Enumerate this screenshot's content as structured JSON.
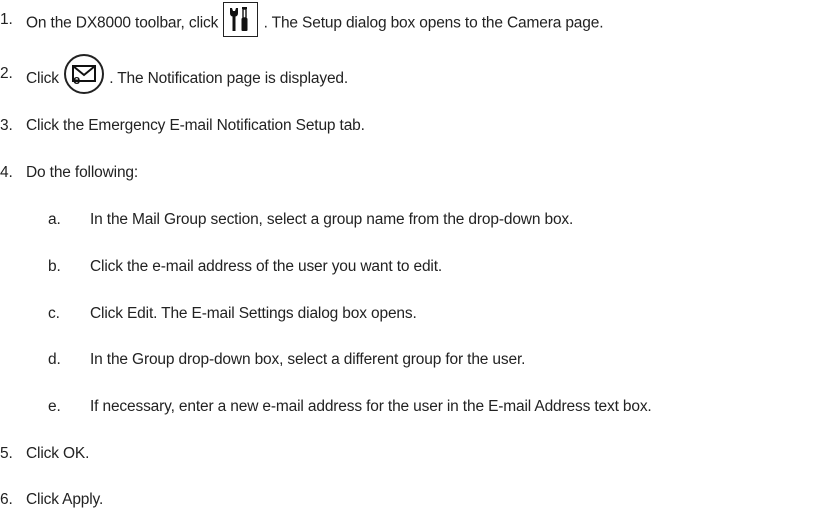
{
  "steps": [
    {
      "num": "1.",
      "before": "On the DX8000 toolbar, click",
      "after": ". The Setup dialog box opens to the Camera page.",
      "icon": "wrench-screwdriver-icon"
    },
    {
      "num": "2.",
      "before": "Click",
      "after": ". The Notification page is displayed.",
      "icon": "email-notification-icon"
    },
    {
      "num": "3.",
      "text": "Click the Emergency E-mail Notification Setup tab."
    },
    {
      "num": "4.",
      "text": "Do the following:"
    },
    {
      "num": "5.",
      "text": "Click OK."
    },
    {
      "num": "6.",
      "text": "Click Apply."
    }
  ],
  "substeps": [
    {
      "letter": "a.",
      "text": "In the Mail Group section, select a group name from the drop-down box."
    },
    {
      "letter": "b.",
      "text": "Click the e-mail address of the user you want to edit."
    },
    {
      "letter": "c.",
      "text": "Click Edit. The E-mail Settings dialog box opens."
    },
    {
      "letter": "d.",
      "text": "In the Group drop-down box, select a different group for the user."
    },
    {
      "letter": "e.",
      "text": "If necessary, enter a new e-mail address for the user in the E-mail Address text box."
    }
  ]
}
